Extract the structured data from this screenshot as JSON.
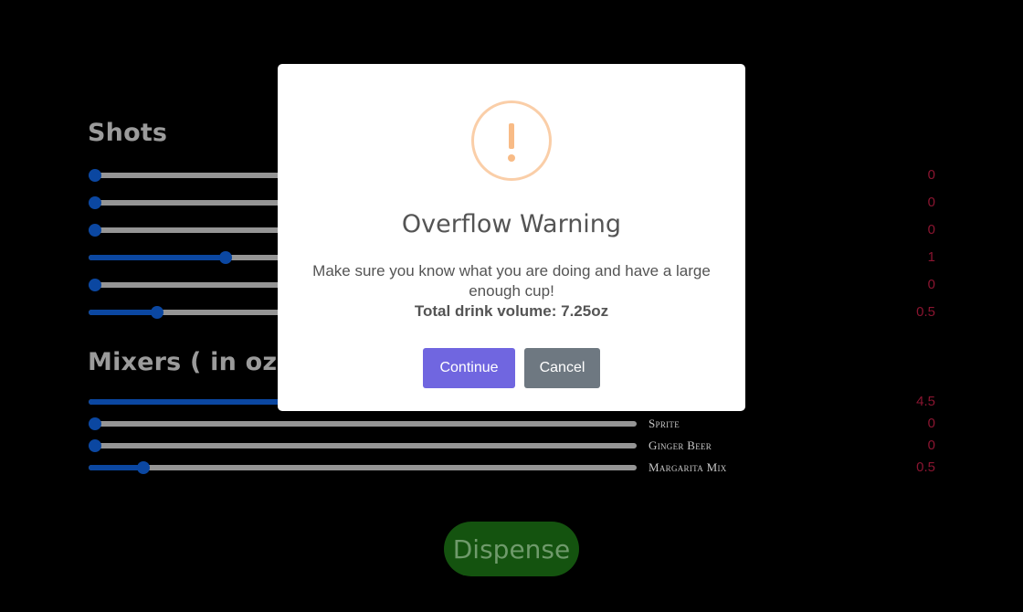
{
  "shots": {
    "title": "Shots",
    "rows": [
      {
        "value": "0",
        "level": 0
      },
      {
        "value": "0",
        "level": 0
      },
      {
        "value": "0",
        "level": 0
      },
      {
        "value": "1",
        "level": 0.25
      },
      {
        "value": "0",
        "level": 0
      },
      {
        "value": "0.5",
        "level": 0.125
      }
    ]
  },
  "mixers": {
    "title": "Mixers ( in oz )",
    "rows": [
      {
        "label": "",
        "value": "4.5",
        "level": 0.5625
      },
      {
        "label": "Sprite",
        "value": "0",
        "level": 0
      },
      {
        "label": "Ginger Beer",
        "value": "0",
        "level": 0
      },
      {
        "label": "Margarita Mix",
        "value": "0.5",
        "level": 0.1
      }
    ]
  },
  "dispense_label": "Dispense",
  "modal": {
    "title": "Overflow Warning",
    "message": "Make sure you know what you are doing and have a large enough cup!",
    "volume_text": "Total drink volume: 7.25oz",
    "continue_label": "Continue",
    "cancel_label": "Cancel"
  },
  "colors": {
    "slider_fill": "#0b47a1",
    "track": "#959595",
    "value_text": "#8a1530",
    "dispense_bg": "#14530f",
    "continue_bg": "#7066e0",
    "cancel_bg": "#6e7881",
    "warning_icon": "#f8bb86"
  }
}
